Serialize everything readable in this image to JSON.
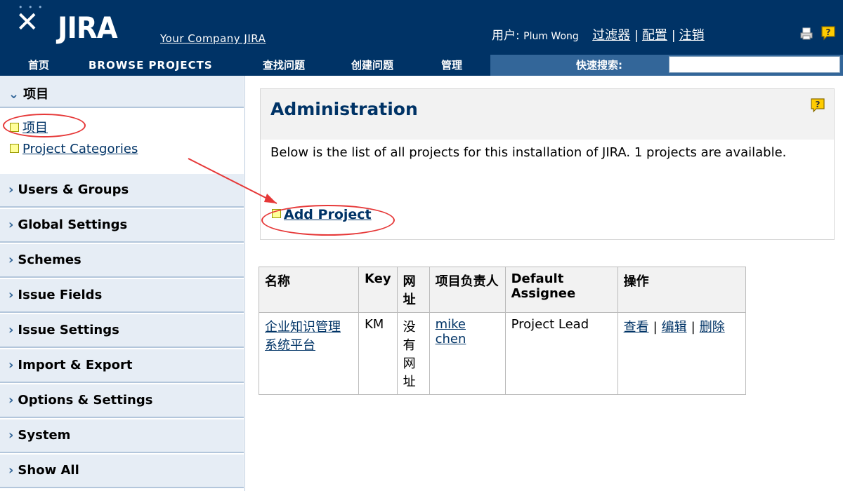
{
  "header": {
    "logo_text": "JIRA",
    "company_link": "Your Company JIRA",
    "user_label": "用户:",
    "user_name": "Plum Wong",
    "links": [
      "过滤器",
      "配置",
      "注销"
    ]
  },
  "nav": {
    "items": [
      "首页",
      "BROWSE PROJECTS",
      "查找问题",
      "创建问题",
      "管理"
    ],
    "quick_search_label": "快速搜索:",
    "quick_search_value": ""
  },
  "sidebar": {
    "section_title": "项目",
    "sub_items": [
      "项目",
      "Project Categories"
    ],
    "groups": [
      "Users & Groups",
      "Global Settings",
      "Schemes",
      "Issue Fields",
      "Issue Settings",
      "Import & Export",
      "Options & Settings",
      "System",
      "Show All"
    ]
  },
  "main": {
    "title": "Administration",
    "description": "Below is the list of all projects for this installation of JIRA. 1 projects are available.",
    "add_project": "Add Project"
  },
  "table": {
    "headers": [
      "名称",
      "Key",
      "网址",
      "项目负责人",
      "Default Assignee",
      "操作"
    ],
    "rows": [
      {
        "name": "企业知识管理系统平台",
        "key": "KM",
        "url": "没有网址",
        "lead": "mike chen",
        "assignee": "Project Lead",
        "actions": [
          "查看",
          "编辑",
          "删除"
        ]
      }
    ]
  },
  "colors": {
    "header_bg": "#003366",
    "nav_bg": "#336699",
    "link": "#003366",
    "annotation": "#e63838"
  }
}
